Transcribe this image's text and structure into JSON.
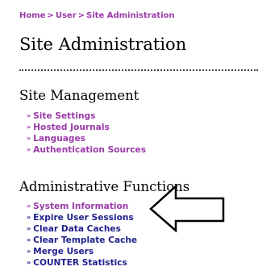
{
  "breadcrumb": {
    "items": [
      "Home",
      "User",
      "Site Administration"
    ],
    "separator": ">"
  },
  "page": {
    "title": "Site Administration"
  },
  "site_management": {
    "heading": "Site Management",
    "links": [
      "Site Settings",
      "Hosted Journals",
      "Languages",
      "Authentication Sources"
    ]
  },
  "admin_functions": {
    "heading": "Administrative Functions",
    "links": [
      "System Information",
      "Expire User Sessions",
      "Clear Data Caches",
      "Clear Template Cache",
      "Merge Users",
      "COUNTER Statistics"
    ]
  },
  "bullet_glyph": "»",
  "colors": {
    "link_visited": "#9a3aa8",
    "link_unvisited": "#1f1f8c",
    "rule": "#444444"
  },
  "annotation": {
    "icon": "left-arrow-icon"
  }
}
